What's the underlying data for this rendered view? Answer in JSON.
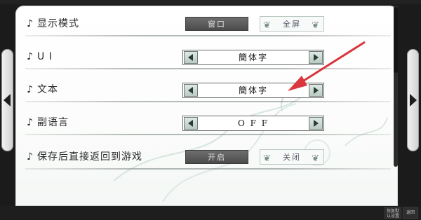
{
  "header": {
    "logo_text": ""
  },
  "rows": [
    {
      "label": "显示模式",
      "type": "toggle",
      "dark_label": "窗口",
      "light_label": "全屏"
    },
    {
      "label": "U I",
      "type": "selector",
      "value": "簡体字"
    },
    {
      "label": "文本",
      "type": "selector",
      "value": "簡体字"
    },
    {
      "label": "副语言",
      "type": "selector",
      "value": "O F F"
    },
    {
      "label": "保存后直接返回到游戏",
      "type": "toggle",
      "dark_label": "开启",
      "light_label": "关闭"
    }
  ],
  "footer": {
    "restore_default_label": "恢复默认设置",
    "back_label": "返回"
  },
  "icons": {
    "row_marker": "music-note-icon",
    "prev_page": "triangle-left-icon",
    "next_page": "triangle-right-icon",
    "annotation": "red-arrow-icon"
  },
  "colors": {
    "annotation": "#d9363e",
    "selected_toggle": "#5a5a5a"
  }
}
